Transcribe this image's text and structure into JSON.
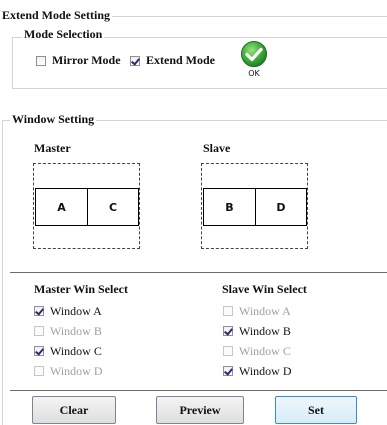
{
  "extend_mode": {
    "title": "Extend Mode Setting",
    "mode_selection": {
      "title": "Mode Selection",
      "mirror_label": "Mirror Mode",
      "mirror_checked": false,
      "extend_label": "Extend Mode",
      "extend_checked": true,
      "ok_label": "OK"
    }
  },
  "window_setting": {
    "title": "Window Setting",
    "master_label": "Master",
    "slave_label": "Slave",
    "master_windows": [
      "A",
      "C"
    ],
    "slave_windows": [
      "B",
      "D"
    ]
  },
  "master_win_select": {
    "title": "Master Win Select",
    "items": [
      {
        "label": "Window A",
        "checked": true,
        "enabled": true
      },
      {
        "label": "Window B",
        "checked": false,
        "enabled": false
      },
      {
        "label": "Window C",
        "checked": true,
        "enabled": true
      },
      {
        "label": "Window D",
        "checked": false,
        "enabled": false
      }
    ]
  },
  "slave_win_select": {
    "title": "Slave Win Select",
    "items": [
      {
        "label": "Window A",
        "checked": false,
        "enabled": false
      },
      {
        "label": "Window B",
        "checked": true,
        "enabled": true
      },
      {
        "label": "Window C",
        "checked": false,
        "enabled": false
      },
      {
        "label": "Window D",
        "checked": true,
        "enabled": true
      }
    ]
  },
  "buttons": {
    "clear": "Clear",
    "preview": "Preview",
    "set": "Set"
  },
  "colors": {
    "ok_icon": "#2ea33b",
    "focus_button": "#2f8fd8"
  }
}
